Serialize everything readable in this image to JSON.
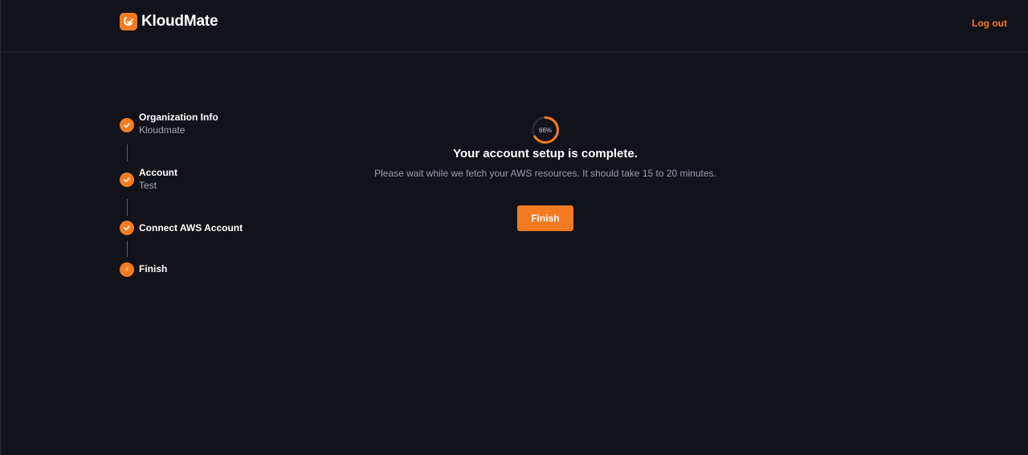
{
  "app": {
    "brand_name": "KloudMate",
    "accent_color": "#f57b20"
  },
  "header": {
    "logout_label": "Log out"
  },
  "stepper": {
    "steps": [
      {
        "title": "Organization Info",
        "subtitle": "Kloudmate",
        "status": "completed",
        "icon": "check-icon"
      },
      {
        "title": "Account",
        "subtitle": "Test",
        "status": "completed",
        "icon": "check-icon"
      },
      {
        "title": "Connect AWS Account",
        "subtitle": "",
        "status": "completed",
        "icon": "check-icon"
      },
      {
        "title": "Finish",
        "subtitle": "",
        "status": "current",
        "number": "4"
      }
    ]
  },
  "main": {
    "progress_percent": 66,
    "progress_label": "66%",
    "headline": "Your account setup is complete.",
    "message": "Please wait while we fetch your AWS resources. It should take 15 to 20 minutes.",
    "finish_label": "Finish"
  }
}
